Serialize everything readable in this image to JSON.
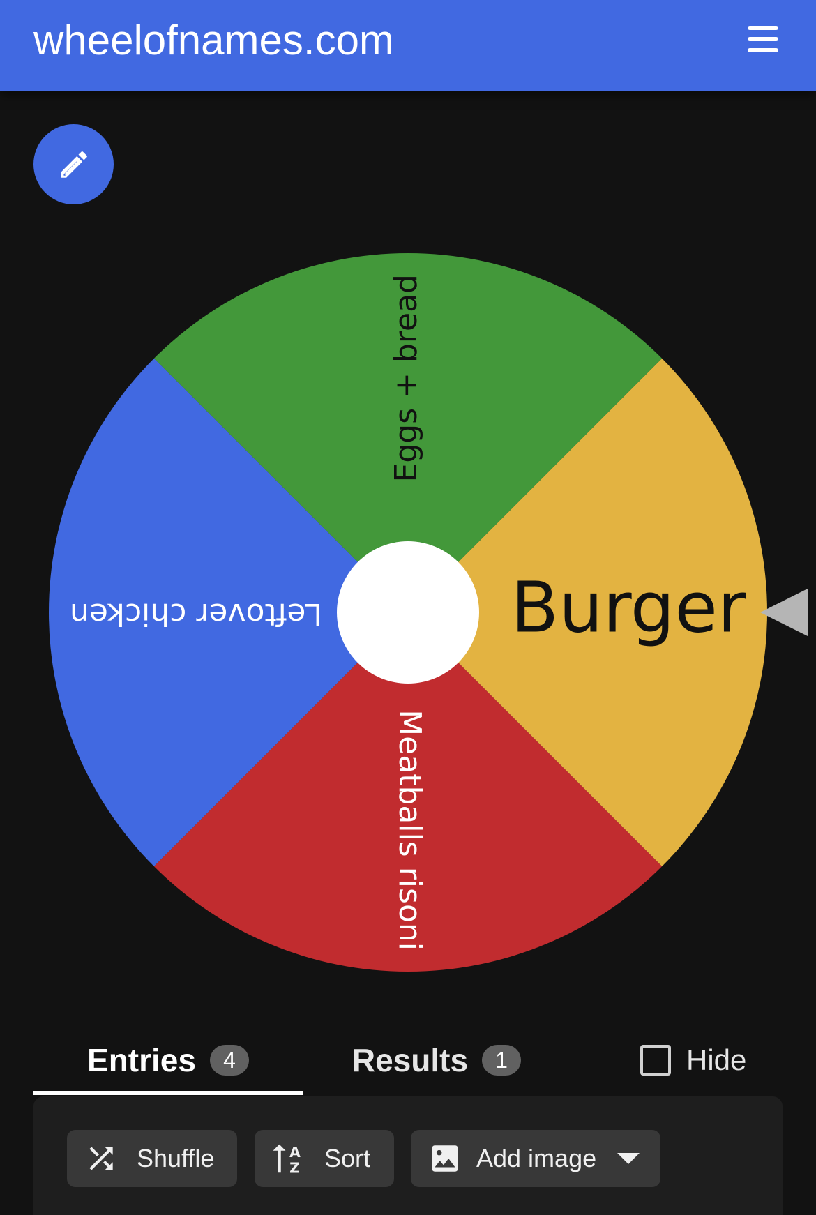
{
  "header": {
    "title": "wheelofnames.com",
    "menu_icon": "hamburger-menu-icon",
    "background_color": "#4169e1"
  },
  "edit_button": {
    "icon": "pencil-icon"
  },
  "wheel": {
    "pointer_icon": "triangle-pointer-icon",
    "center_hub_color": "#ffffff",
    "segments": [
      {
        "label": "Burger",
        "color": "#e3b341",
        "text_color": "#111111"
      },
      {
        "label": "Eggs + bread",
        "color": "#43983a",
        "text_color": "#111111"
      },
      {
        "label": "Leftover chicken",
        "color": "#4169e1",
        "text_color": "#ffffff"
      },
      {
        "label": "Meatballs risoni",
        "color": "#c12c2f",
        "text_color": "#ffffff"
      }
    ]
  },
  "tabs": {
    "entries": {
      "label": "Entries",
      "count": "4"
    },
    "results": {
      "label": "Results",
      "count": "1"
    },
    "hide": {
      "label": "Hide",
      "checked": false
    }
  },
  "toolbar": {
    "shuffle_label": "Shuffle",
    "shuffle_icon": "shuffle-icon",
    "sort_label": "Sort",
    "sort_icon": "sort-alpha-icon",
    "add_image_label": "Add image",
    "add_image_icon": "image-icon",
    "add_image_caret": "caret-down-icon"
  }
}
